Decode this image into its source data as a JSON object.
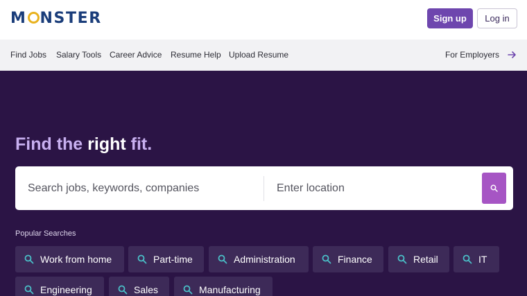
{
  "brand": {
    "logo_left": "M",
    "logo_right": "NSTER",
    "accent_color": "#6e46ae"
  },
  "header": {
    "signup_label": "Sign up",
    "login_label": "Log in"
  },
  "nav": {
    "items": [
      "Find Jobs",
      "Salary Tools",
      "Career Advice",
      "Resume Help",
      "Upload Resume"
    ],
    "employers_label": "For Employers"
  },
  "hero": {
    "headline_part1": "Find the ",
    "headline_strong": "right",
    "headline_part2": " fit.",
    "search_placeholder": "Search jobs, keywords, companies",
    "location_placeholder": "Enter location",
    "popular_label": "Popular Searches",
    "chips": [
      "Work from home",
      "Part-time",
      "Administration",
      "Finance",
      "Retail",
      "IT",
      "Engineering",
      "Sales",
      "Manufacturing"
    ]
  },
  "icons": {
    "search": "search-icon",
    "arrow": "arrow-right-icon"
  }
}
